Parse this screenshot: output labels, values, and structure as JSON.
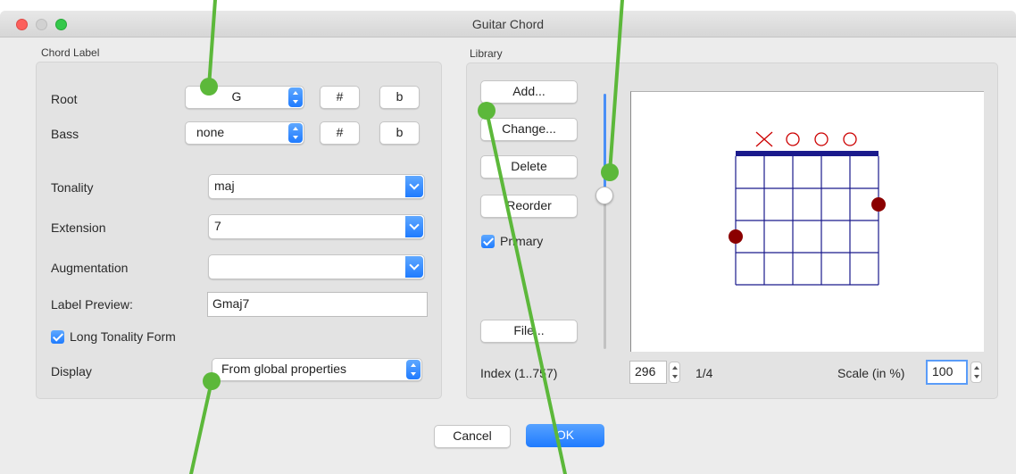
{
  "window": {
    "title": "Guitar Chord"
  },
  "chord_label": {
    "group_title": "Chord Label",
    "root": {
      "label": "Root",
      "value": "G",
      "sharp": "#",
      "flat": "b"
    },
    "bass": {
      "label": "Bass",
      "value": "none",
      "sharp": "#",
      "flat": "b"
    },
    "tonality": {
      "label": "Tonality",
      "value": "maj"
    },
    "extension": {
      "label": "Extension",
      "value": "7"
    },
    "augmentation": {
      "label": "Augmentation",
      "value": ""
    },
    "label_preview": {
      "label": "Label Preview:",
      "value": "Gmaj7"
    },
    "long_tonality": {
      "label": "Long Tonality Form",
      "checked": true
    },
    "display": {
      "label": "Display",
      "value": "From global properties"
    }
  },
  "library": {
    "group_title": "Library",
    "buttons": {
      "add": "Add...",
      "change": "Change...",
      "delete": "Delete",
      "reorder": "Reorder",
      "file": "File..."
    },
    "primary": {
      "label": "Primary",
      "checked": true
    },
    "index": {
      "label": "Index (1..757)",
      "value": "296",
      "page": "1/4"
    },
    "scale": {
      "label": "Scale (in %)",
      "value": "100"
    },
    "diagram": {
      "string_markers": [
        "X",
        "O",
        "O",
        "O"
      ],
      "string_count": 6,
      "fret_count": 4,
      "fingered_notes": [
        {
          "string": 6,
          "fret": 3
        },
        {
          "string": 1,
          "fret": 2
        }
      ]
    }
  },
  "footer": {
    "cancel": "Cancel",
    "ok": "OK"
  },
  "colors": {
    "accent": "#1f7bff",
    "annotation": "#5cb83a",
    "diagram_line": "#1a1a8c",
    "note_dot": "#8b0000",
    "marker": "#cc0000"
  }
}
